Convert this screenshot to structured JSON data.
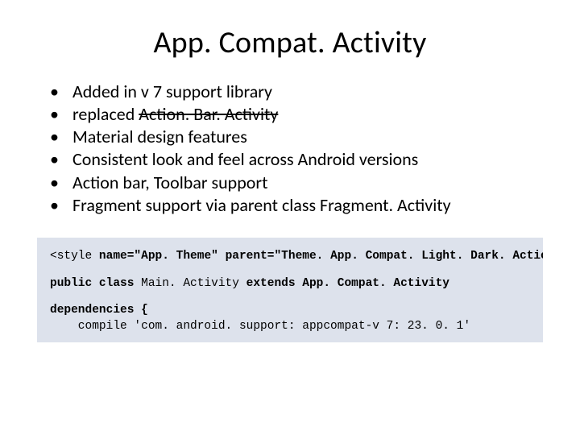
{
  "title": "App. Compat. Activity",
  "bullets": [
    {
      "pre": "Added in v 7 support library",
      "strike": "",
      "post": ""
    },
    {
      "pre": "replaced ",
      "strike": "Action. Bar. Activity",
      "post": ""
    },
    {
      "pre": "Material design features",
      "strike": "",
      "post": ""
    },
    {
      "pre": "Consistent look and feel across Android versions",
      "strike": "",
      "post": ""
    },
    {
      "pre": "Action bar, Toolbar support",
      "strike": "",
      "post": ""
    },
    {
      "pre": "Fragment support via parent class Fragment. Activity",
      "strike": "",
      "post": ""
    }
  ],
  "code": {
    "line1_a": "<style ",
    "line1_b": "name=\"App. Theme\"",
    "line1_c": " ",
    "line1_d": "parent=\"Theme. App. Compat. Light. Dark. Action. Bar\">",
    "line2_a": "public class ",
    "line2_b": "Main. Activity ",
    "line2_c": "extends App. Compat. Activity",
    "line3": "dependencies {",
    "line4": "    compile 'com. android. support: appcompat-v 7: 23. 0. 1'"
  }
}
